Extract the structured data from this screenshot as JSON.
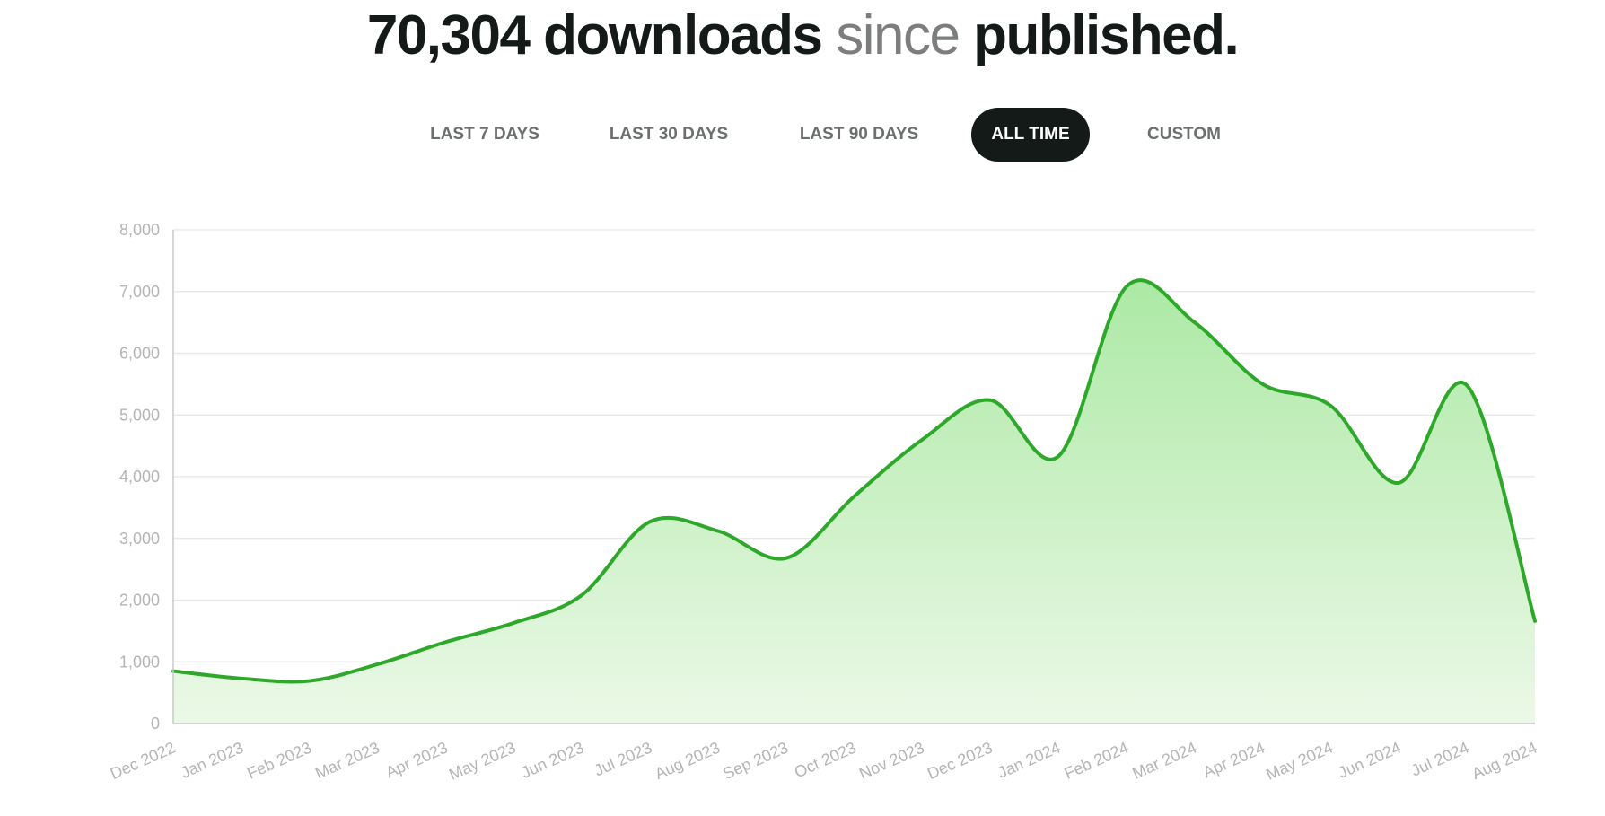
{
  "headline": {
    "count": "70,304 downloads",
    "since": "since",
    "published": "published."
  },
  "tabs": [
    {
      "label": "LAST 7 DAYS",
      "active": false
    },
    {
      "label": "LAST 30 DAYS",
      "active": false
    },
    {
      "label": "LAST 90 DAYS",
      "active": false
    },
    {
      "label": "ALL TIME",
      "active": true
    },
    {
      "label": "CUSTOM",
      "active": false
    }
  ],
  "colors": {
    "line": "#2ea82a",
    "fill_top": "#a8e8a0",
    "fill_bottom": "#eaf8e6",
    "grid": "#e6e6e6",
    "axis": "#c8c8c8",
    "active_tab_bg": "#141a17"
  },
  "chart_data": {
    "type": "area",
    "title": "",
    "xlabel": "",
    "ylabel": "",
    "ylim": [
      0,
      8000
    ],
    "yticks": [
      0,
      1000,
      2000,
      3000,
      4000,
      5000,
      6000,
      7000,
      8000
    ],
    "ytick_labels": [
      "0",
      "1,000",
      "2,000",
      "3,000",
      "4,000",
      "5,000",
      "6,000",
      "7,000",
      "8,000"
    ],
    "grid": true,
    "legend": "none",
    "categories": [
      "Dec 2022",
      "Jan 2023",
      "Feb 2023",
      "Mar 2023",
      "Apr 2023",
      "May 2023",
      "Jun 2023",
      "Jul 2023",
      "Aug 2023",
      "Sep 2023",
      "Oct 2023",
      "Nov 2023",
      "Dec 2023",
      "Jan 2024",
      "Feb 2024",
      "Mar 2024",
      "Apr 2024",
      "May 2024",
      "Jun 2024",
      "Jul 2024",
      "Aug 2024"
    ],
    "values": [
      850,
      730,
      690,
      960,
      1320,
      1630,
      2080,
      3270,
      3120,
      2680,
      3680,
      4600,
      5240,
      4330,
      7080,
      6500,
      5500,
      5150,
      3900,
      5480,
      1660
    ]
  }
}
